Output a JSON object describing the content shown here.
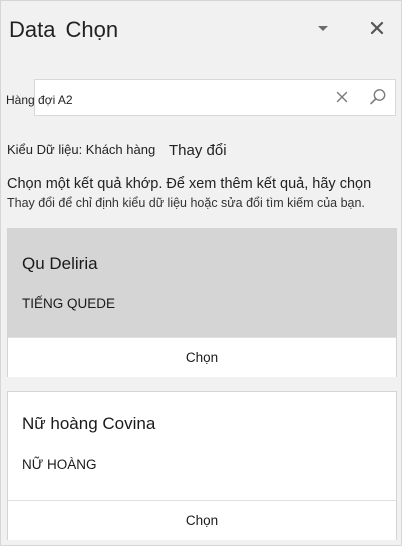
{
  "pane": {
    "title_part1": "Data",
    "title_part2": "Chọn"
  },
  "search": {
    "value": "Hàng đợi A2"
  },
  "data_type": {
    "label": "Kiểu Dữ liệu: Khách hàng",
    "change_link": "Thay đổi"
  },
  "info": {
    "line1": "Chọn một kết quả khớp. Để xem thêm kết quả, hãy chọn",
    "line2": "Thay đổi để chỉ định kiểu dữ liệu hoặc sửa đổi tìm kiếm của bạn."
  },
  "results": [
    {
      "name": "Qu Deliria",
      "subtitle": "TIẾNG QUEDE",
      "select_label": "Chọn",
      "selected": true
    },
    {
      "name": "Nữ hoàng Covina",
      "subtitle": "NỮ HOÀNG",
      "select_label": "Chọn",
      "selected": false
    }
  ],
  "icons": {
    "dropdown": "chevron-down-icon",
    "close": "close-icon",
    "clear": "clear-icon",
    "search": "search-icon"
  }
}
